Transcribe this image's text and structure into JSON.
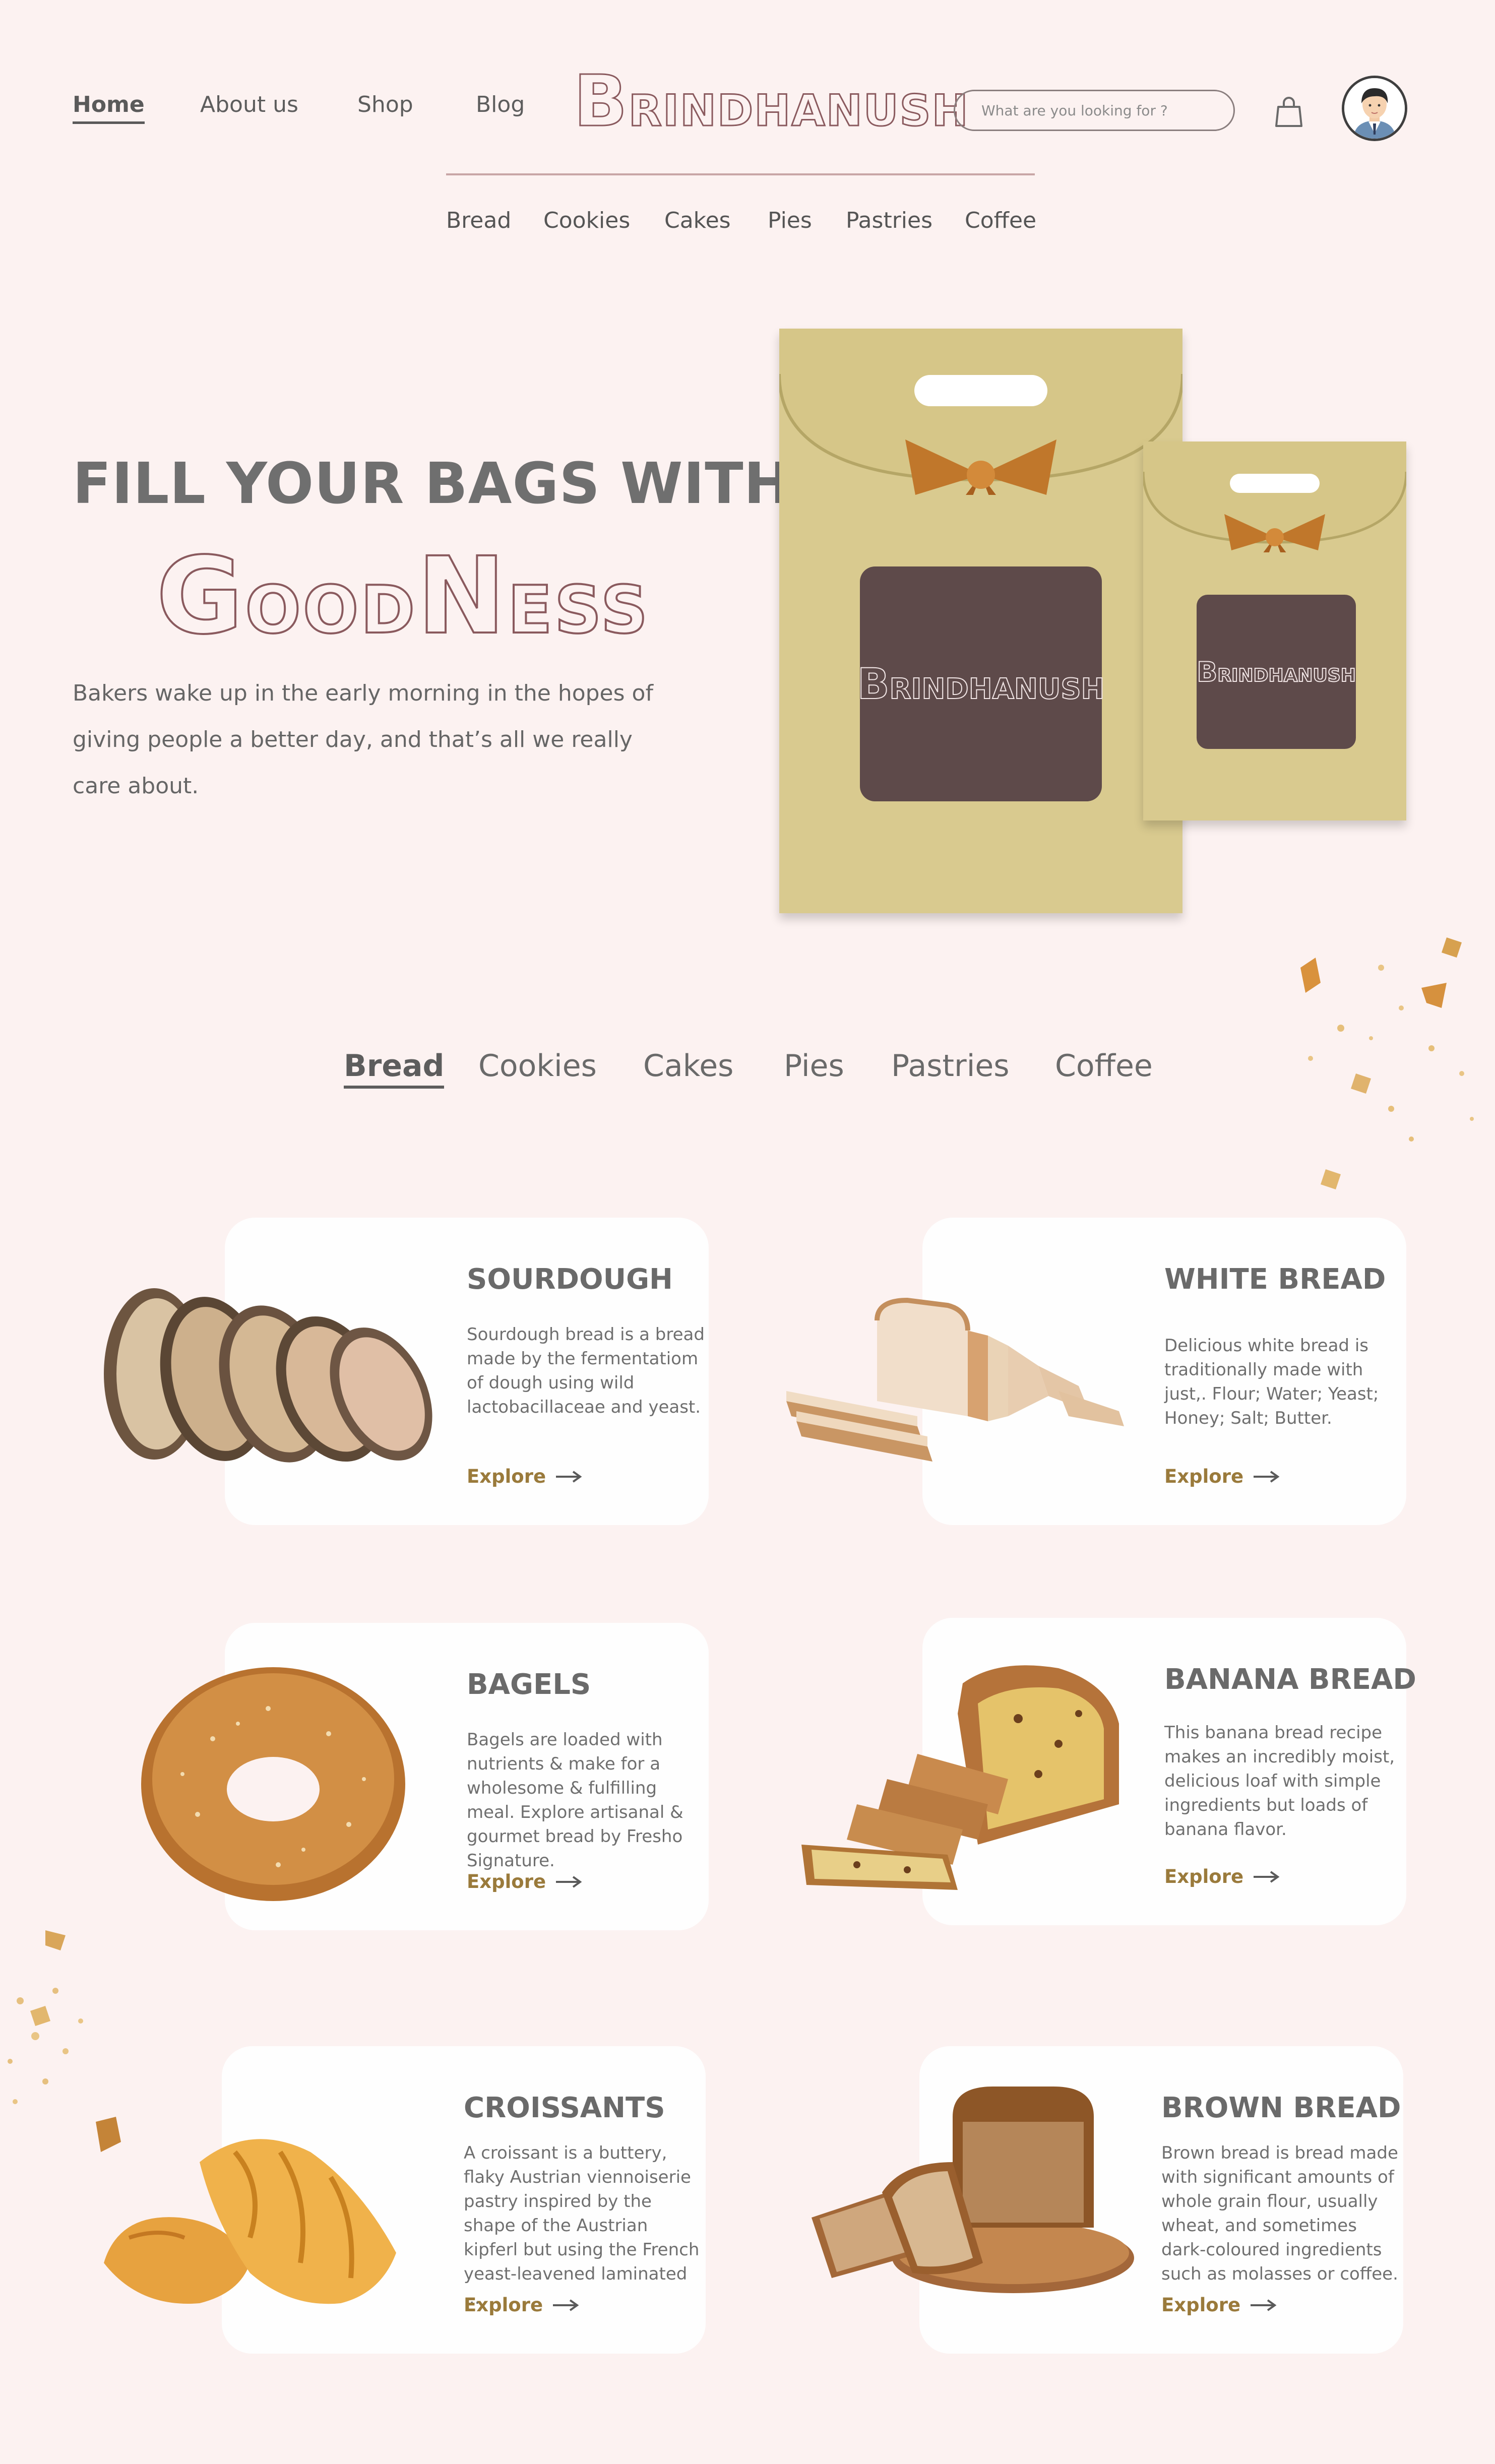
{
  "header": {
    "nav": [
      "Home",
      "About us",
      "Shop",
      "Blog"
    ],
    "brand_initial": "B",
    "brand_rest": "RINDHANUSH",
    "search_placeholder": "What are you looking for ?",
    "subnav": [
      "Bread",
      "Cookies",
      "Cakes",
      "Pies",
      "Pastries",
      "Coffee"
    ]
  },
  "hero": {
    "title": "FILL YOUR BAGS WITH",
    "goodness": [
      "G",
      "OOD",
      "N",
      "ESS"
    ],
    "description": "Bakers wake up in the early morning in the hopes of giving people a better day, and that’s all we really care about.",
    "bag_brand_initial": "B",
    "bag_brand_rest": "RINDHANUSH"
  },
  "categories": {
    "tabs": [
      "Bread",
      "Cookies",
      "Cakes",
      "Pies",
      "Pastries",
      "Coffee"
    ],
    "active": "Bread"
  },
  "products": [
    {
      "title": "SOURDOUGH",
      "desc": "Sourdough bread is a bread made by the fermentatiom of dough using wild lactobacillaceae and yeast.",
      "cta": "Explore"
    },
    {
      "title": "WHITE BREAD",
      "desc": "Delicious white bread is traditionally made with just,. Flour; Water; Yeast; Honey; Salt; Butter.",
      "cta": "Explore"
    },
    {
      "title": "BAGELS",
      "desc": "Bagels are loaded with nutrients & make for a wholesome & fulfilling meal. Explore artisanal & gourmet bread by Fresho Signature.",
      "cta": "Explore"
    },
    {
      "title": "BANANA BREAD",
      "desc": "This banana bread recipe makes an incredibly moist, delicious loaf with simple ingredients but loads of banana flavor.",
      "cta": "Explore"
    },
    {
      "title": "CROISSANTS",
      "desc": "A croissant is a buttery, flaky Austrian viennoiserie pastry inspired by the shape of the Austrian kipferl but using the French yeast-leavened laminated ...",
      "cta": "Explore"
    },
    {
      "title": "BROWN BREAD",
      "desc": "Brown bread is bread made with significant amounts of whole grain flour, usually wheat, and sometimes dark-coloured ingredients such as molasses or coffee.",
      "cta": "Explore"
    }
  ],
  "icons": {
    "cart": "shopping-bag-icon",
    "avatar": "user-avatar",
    "arrow": "arrow-right-icon"
  },
  "colors": {
    "background": "#fcf2f1",
    "brand": "#8a5a5e",
    "bag": "#d9ca8f",
    "bag_label": "#5e4a4a",
    "explore": "#9a7a3b"
  }
}
